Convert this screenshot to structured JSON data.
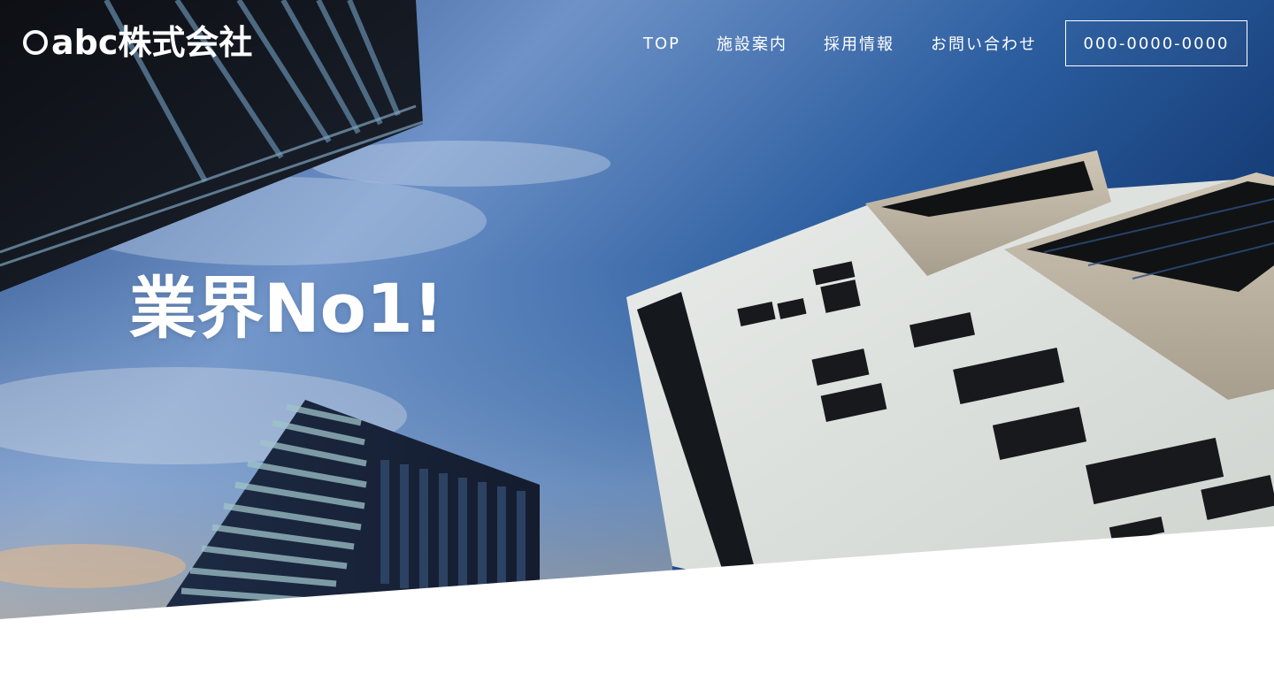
{
  "header": {
    "logo_text": "abc株式会社",
    "nav": [
      {
        "label": "TOP"
      },
      {
        "label": "施設案内"
      },
      {
        "label": "採用情報"
      },
      {
        "label": "お問い合わせ"
      }
    ],
    "phone_label": "000-0000-0000"
  },
  "hero": {
    "headline": "業界No1!",
    "image": "buildings-sky-photo"
  },
  "colors": {
    "sky_top": "#0b2d63",
    "sky_mid": "#3f6fa8",
    "text": "#ffffff",
    "page_bg": "#ffffff"
  }
}
